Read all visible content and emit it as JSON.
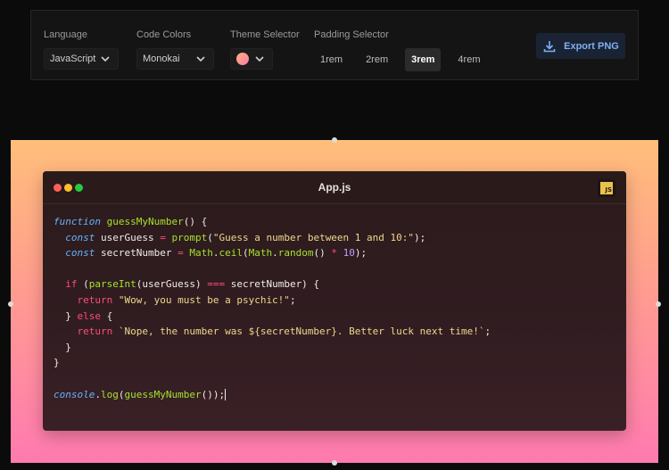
{
  "toolbar": {
    "language": {
      "label": "Language",
      "value": "JavaScript"
    },
    "code_colors": {
      "label": "Code Colors",
      "value": "Monokai"
    },
    "theme": {
      "label": "Theme Selector",
      "swatch_colors": [
        "#ffb27a",
        "#ff7aa8"
      ]
    },
    "padding": {
      "label": "Padding Selector",
      "options": [
        "1rem",
        "2rem",
        "3rem",
        "4rem"
      ],
      "selected": "3rem"
    },
    "export": {
      "label": "Export PNG",
      "icon": "download-icon"
    }
  },
  "canvas": {
    "background_colors": [
      "#ffbe7a",
      "#ff9d8f",
      "#ff7ab0"
    ]
  },
  "editor": {
    "title": "App.js",
    "lang_badge": "JS",
    "dot_colors": [
      "#ff5f57",
      "#febc2e",
      "#28c840"
    ],
    "code_lines": [
      "function guessMyNumber() {",
      "  const userGuess = prompt(\"Guess a number between 1 and 10:\");",
      "  const secretNumber = Math.ceil(Math.random() * 10);",
      "",
      "  if (parseInt(userGuess) === secretNumber) {",
      "    return \"Wow, you must be a psychic!\";",
      "  } else {",
      "    return `Nope, the number was ${secretNumber}. Better luck next time!`;",
      "  }",
      "}",
      "",
      "console.log(guessMyNumber());"
    ]
  }
}
